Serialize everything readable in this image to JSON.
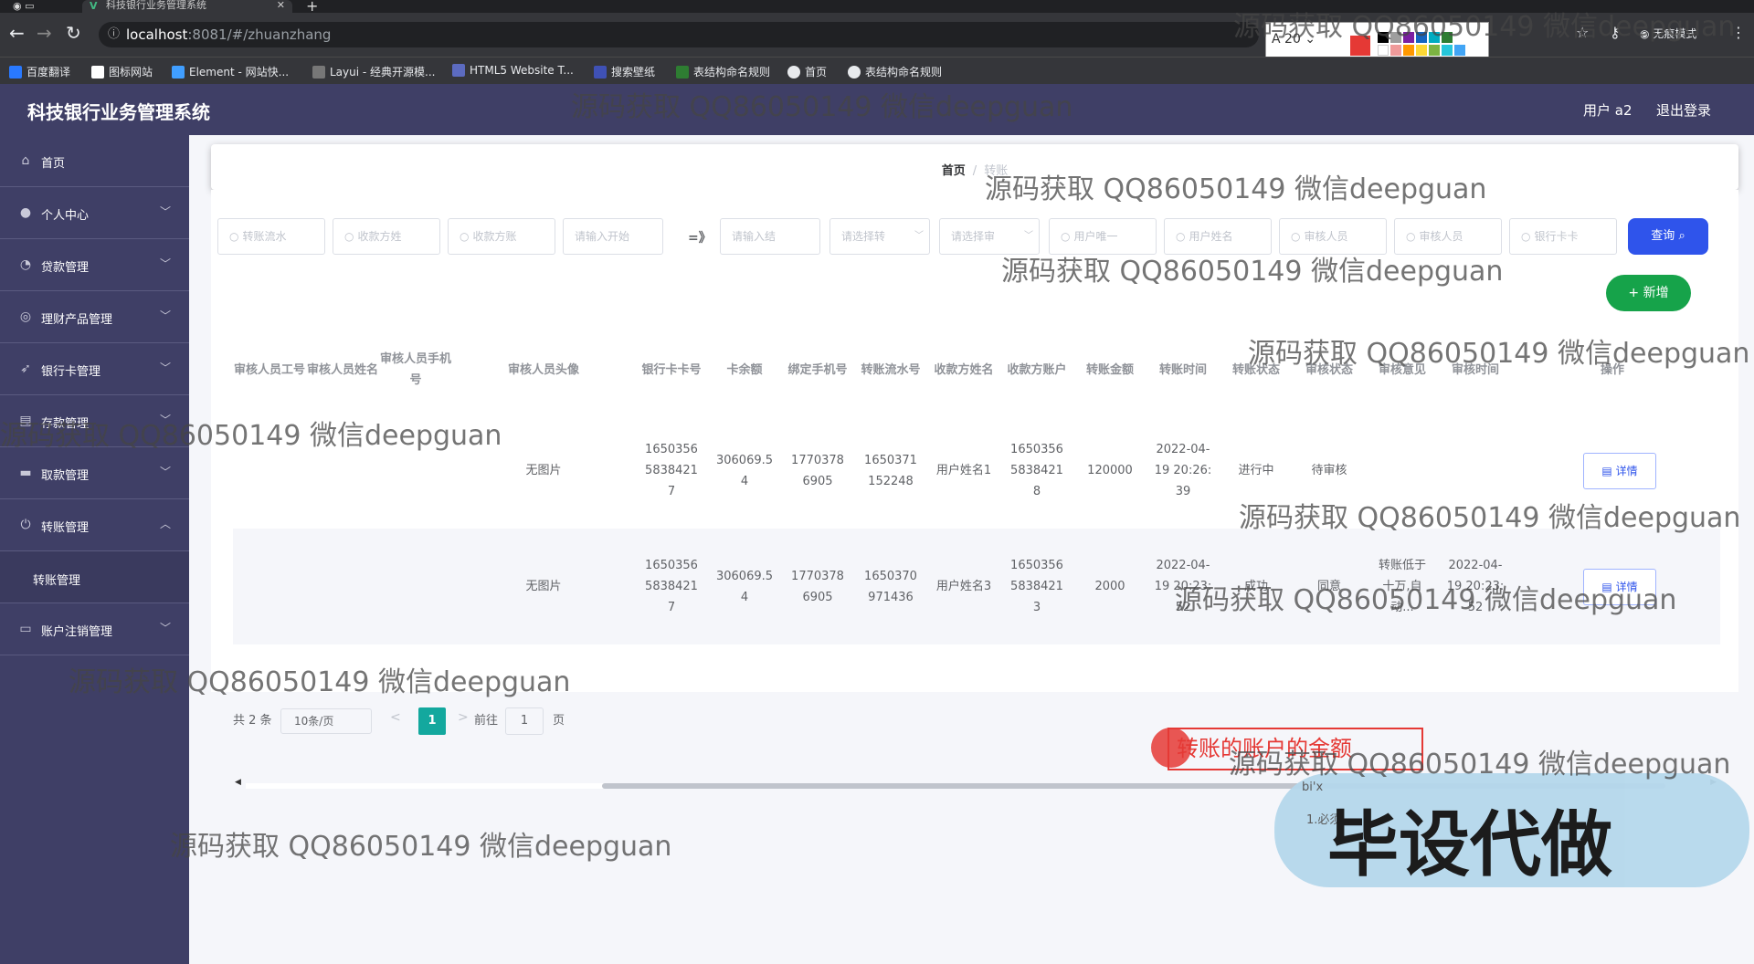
{
  "browser": {
    "tab_title": "科技银行业务管理系统",
    "url_host": "localhost",
    "url_path": ":8081/#/zhuanzhang",
    "draw_font_size": "20",
    "incognito_label": "无痕模式",
    "bookmarks": [
      "百度翻译",
      "图标网站",
      "Element - 网站快...",
      "Layui - 经典开源模...",
      "HTML5 Website T...",
      "搜索壁纸",
      "表结构命名规则",
      "首页",
      "表结构命名规则"
    ]
  },
  "header": {
    "title": "科技银行业务管理系统",
    "user": "用户 a2",
    "logout": "退出登录"
  },
  "sidebar": {
    "items": [
      {
        "label": "首页",
        "icon": "home-icon",
        "chevron": ""
      },
      {
        "label": "个人中心",
        "icon": "user-icon",
        "chevron": "﹀"
      },
      {
        "label": "贷款管理",
        "icon": "loan-icon",
        "chevron": "﹀"
      },
      {
        "label": "理财产品管理",
        "icon": "product-icon",
        "chevron": "﹀"
      },
      {
        "label": "银行卡管理",
        "icon": "send-icon",
        "chevron": "﹀"
      },
      {
        "label": "存款管理",
        "icon": "deposit-icon",
        "chevron": "﹀"
      },
      {
        "label": "取款管理",
        "icon": "withdraw-icon",
        "chevron": "﹀"
      },
      {
        "label": "转账管理",
        "icon": "power-icon",
        "chevron": "︿"
      },
      {
        "label": "账户注销管理",
        "icon": "monitor-icon",
        "chevron": "﹀"
      }
    ],
    "submenu": "转账管理"
  },
  "breadcrumb": {
    "home": "首页",
    "sep": "/",
    "current": "转账"
  },
  "filters": {
    "f1": "转账流水",
    "f2": "收款方姓",
    "f3": "收款方账",
    "f4": "请输入开始",
    "approx": "=》",
    "f5": "请输入结",
    "f6": "请选择转",
    "f7": "请选择审",
    "f8": "用户唯一",
    "f9": "用户姓名",
    "f10": "审核人员",
    "f11": "审核人员",
    "f12": "银行卡卡",
    "search": "查询",
    "add": "新增"
  },
  "table": {
    "headers": [
      "审核人员工号",
      "审核人员姓名",
      "审核人员手机号",
      "审核人员头像",
      "银行卡卡号",
      "卡余额",
      "绑定手机号",
      "转账流水号",
      "收款方姓名",
      "收款方账户",
      "转账金额",
      "转账时间",
      "转账状态",
      "审核状态",
      "审核意见",
      "审核时间",
      "操作"
    ],
    "rows": [
      [
        "",
        "",
        "",
        "无图片",
        "16503565838421 7",
        "306069.54",
        "17703786905",
        "1650371152248",
        "用户姓名1",
        "16503565838421 8",
        "120000",
        "2022-04-19 20:26:39",
        "进行中",
        "待审核",
        "",
        "",
        "详情"
      ],
      [
        "",
        "",
        "",
        "无图片",
        "16503565838421 7",
        "306069.54",
        "17703786905",
        "1650370971436",
        "用户姓名3",
        "16503565838421 3",
        "2000",
        "2022-04-19 20:23:52",
        "成功",
        "同意",
        "转账低于十万,自动...",
        "2022-04-19 20:23:52",
        "详情"
      ]
    ]
  },
  "pager": {
    "total": "共 2 条",
    "size": "10条/页",
    "prev": "<",
    "page": "1",
    "next": ">",
    "goto": "前往",
    "jump": "1",
    "unit": "页"
  },
  "overlay": {
    "annotation": "转账的账户的金额",
    "promo": "毕设代做",
    "promo_small1": "bi'x",
    "promo_small2": "1.必须",
    "watermark": "源码获取 QQ86050149 微信deepguan"
  },
  "colors": {
    "sidebar": "#3f3f66",
    "primary": "#2f54eb",
    "success": "#16a34a",
    "pager_active": "#13a89e"
  }
}
